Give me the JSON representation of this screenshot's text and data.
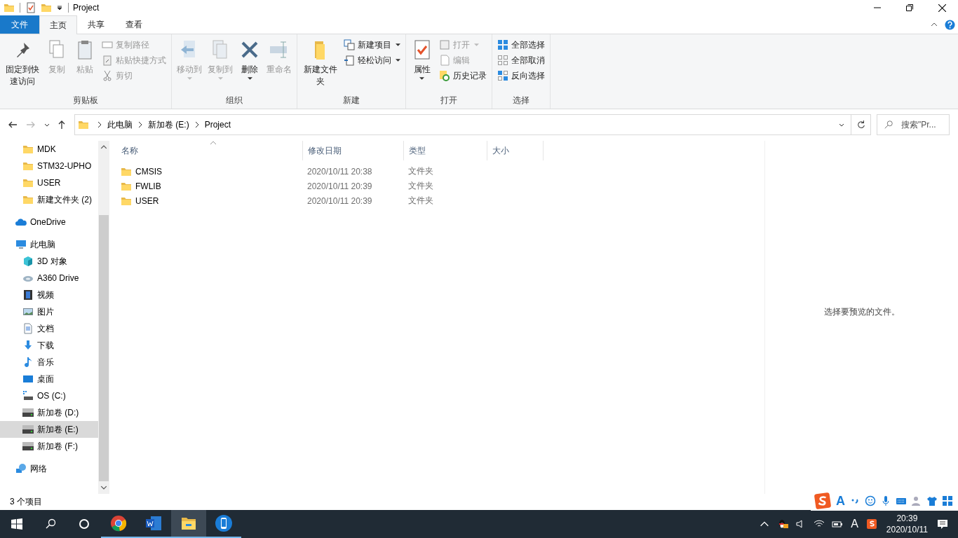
{
  "window": {
    "title": "Project"
  },
  "ribbon_tabs": [
    {
      "label": "文件",
      "kind": "file",
      "selected": false
    },
    {
      "label": "主页",
      "kind": "tab",
      "selected": true
    },
    {
      "label": "共享",
      "kind": "tab",
      "selected": false
    },
    {
      "label": "查看",
      "kind": "tab",
      "selected": false
    }
  ],
  "ribbon_groups": [
    {
      "label": "剪贴板",
      "items": [
        {
          "label": "固定到快速访问",
          "kind": "large",
          "disabled": false,
          "dropdown": false
        },
        {
          "label": "复制",
          "kind": "large",
          "disabled": true,
          "dropdown": false
        },
        {
          "label": "粘贴",
          "kind": "large",
          "disabled": true,
          "dropdown": false
        },
        {
          "label": "复制路径",
          "kind": "small",
          "disabled": true,
          "dropdown": false
        },
        {
          "label": "粘贴快捷方式",
          "kind": "small",
          "disabled": true,
          "dropdown": false
        },
        {
          "label": "剪切",
          "kind": "small",
          "disabled": true,
          "dropdown": false
        }
      ]
    },
    {
      "label": "组织",
      "items": [
        {
          "label": "移动到",
          "kind": "large",
          "disabled": true,
          "dropdown": true
        },
        {
          "label": "复制到",
          "kind": "large",
          "disabled": true,
          "dropdown": true
        },
        {
          "label": "删除",
          "kind": "large",
          "disabled": false,
          "dropdown": true
        },
        {
          "label": "重命名",
          "kind": "large",
          "disabled": true,
          "dropdown": false
        }
      ]
    },
    {
      "label": "新建",
      "items": [
        {
          "label": "新建文件夹",
          "kind": "large",
          "disabled": false,
          "dropdown": false
        },
        {
          "label": "新建项目",
          "kind": "small",
          "disabled": false,
          "dropdown": true
        },
        {
          "label": "轻松访问",
          "kind": "small",
          "disabled": false,
          "dropdown": true
        }
      ]
    },
    {
      "label": "打开",
      "items": [
        {
          "label": "属性",
          "kind": "large",
          "disabled": false,
          "dropdown": true
        },
        {
          "label": "打开",
          "kind": "small",
          "disabled": true,
          "dropdown": true
        },
        {
          "label": "编辑",
          "kind": "small",
          "disabled": true,
          "dropdown": false
        },
        {
          "label": "历史记录",
          "kind": "small",
          "disabled": false,
          "dropdown": false
        }
      ]
    },
    {
      "label": "选择",
      "items": [
        {
          "label": "全部选择",
          "kind": "small",
          "disabled": false,
          "dropdown": false
        },
        {
          "label": "全部取消",
          "kind": "small",
          "disabled": false,
          "dropdown": false
        },
        {
          "label": "反向选择",
          "kind": "small",
          "disabled": false,
          "dropdown": false
        }
      ]
    }
  ],
  "address": {
    "breadcrumb": [
      "此电脑",
      "新加卷 (E:)",
      "Project"
    ],
    "forward_disabled": true
  },
  "search": {
    "placeholder": "搜索\"Pr..."
  },
  "nav_tree": [
    {
      "children": [
        {
          "label": "MDK",
          "kind": "folder",
          "selected": false
        },
        {
          "label": "STM32-UPHO",
          "kind": "folder",
          "selected": false
        },
        {
          "label": "USER",
          "kind": "folder",
          "selected": false
        },
        {
          "label": "新建文件夹 (2)",
          "kind": "folder",
          "selected": false
        }
      ]
    },
    {
      "label": "OneDrive",
      "kind": "onedrive",
      "selected": false
    },
    {
      "label": "此电脑",
      "kind": "pc",
      "selected": false,
      "children": [
        {
          "label": "3D 对象",
          "kind": "cube",
          "selected": false
        },
        {
          "label": "A360 Drive",
          "kind": "cloud",
          "selected": false
        },
        {
          "label": "视频",
          "kind": "video",
          "selected": false
        },
        {
          "label": "图片",
          "kind": "image",
          "selected": false
        },
        {
          "label": "文档",
          "kind": "doc",
          "selected": false
        },
        {
          "label": "下载",
          "kind": "download",
          "selected": false
        },
        {
          "label": "音乐",
          "kind": "music",
          "selected": false
        },
        {
          "label": "桌面",
          "kind": "desktop",
          "selected": false
        },
        {
          "label": "OS (C:)",
          "kind": "osdrive",
          "selected": false
        },
        {
          "label": "新加卷 (D:)",
          "kind": "drive",
          "selected": false
        },
        {
          "label": "新加卷 (E:)",
          "kind": "drive",
          "selected": true
        },
        {
          "label": "新加卷 (F:)",
          "kind": "drive",
          "selected": false
        }
      ]
    },
    {
      "label": "网络",
      "kind": "network",
      "selected": false
    }
  ],
  "file_list": {
    "columns": [
      {
        "label": "名称",
        "sorted": true
      },
      {
        "label": "修改日期",
        "sorted": false
      },
      {
        "label": "类型",
        "sorted": false
      },
      {
        "label": "大小",
        "sorted": false
      }
    ],
    "rows": [
      {
        "name": "CMSIS",
        "modified": "2020/10/11 20:38",
        "type": "文件夹"
      },
      {
        "name": "FWLIB",
        "modified": "2020/10/11 20:39",
        "type": "文件夹"
      },
      {
        "name": "USER",
        "modified": "2020/10/11 20:39",
        "type": "文件夹"
      }
    ]
  },
  "preview_pane": {
    "message": "选择要预览的文件。"
  },
  "status_bar": {
    "item_count": "3 个项目"
  },
  "ime_bar": {
    "mode": "A"
  },
  "taskbar": {
    "apps": [
      {
        "kind": "chrome",
        "open": true,
        "selected": false
      },
      {
        "kind": "word",
        "open": true,
        "selected": false
      },
      {
        "kind": "explorer",
        "open": true,
        "selected": true
      },
      {
        "kind": "phone",
        "open": true,
        "selected": false
      }
    ],
    "tray_ime": "A",
    "time": "20:39",
    "date": "2020/10/11"
  }
}
